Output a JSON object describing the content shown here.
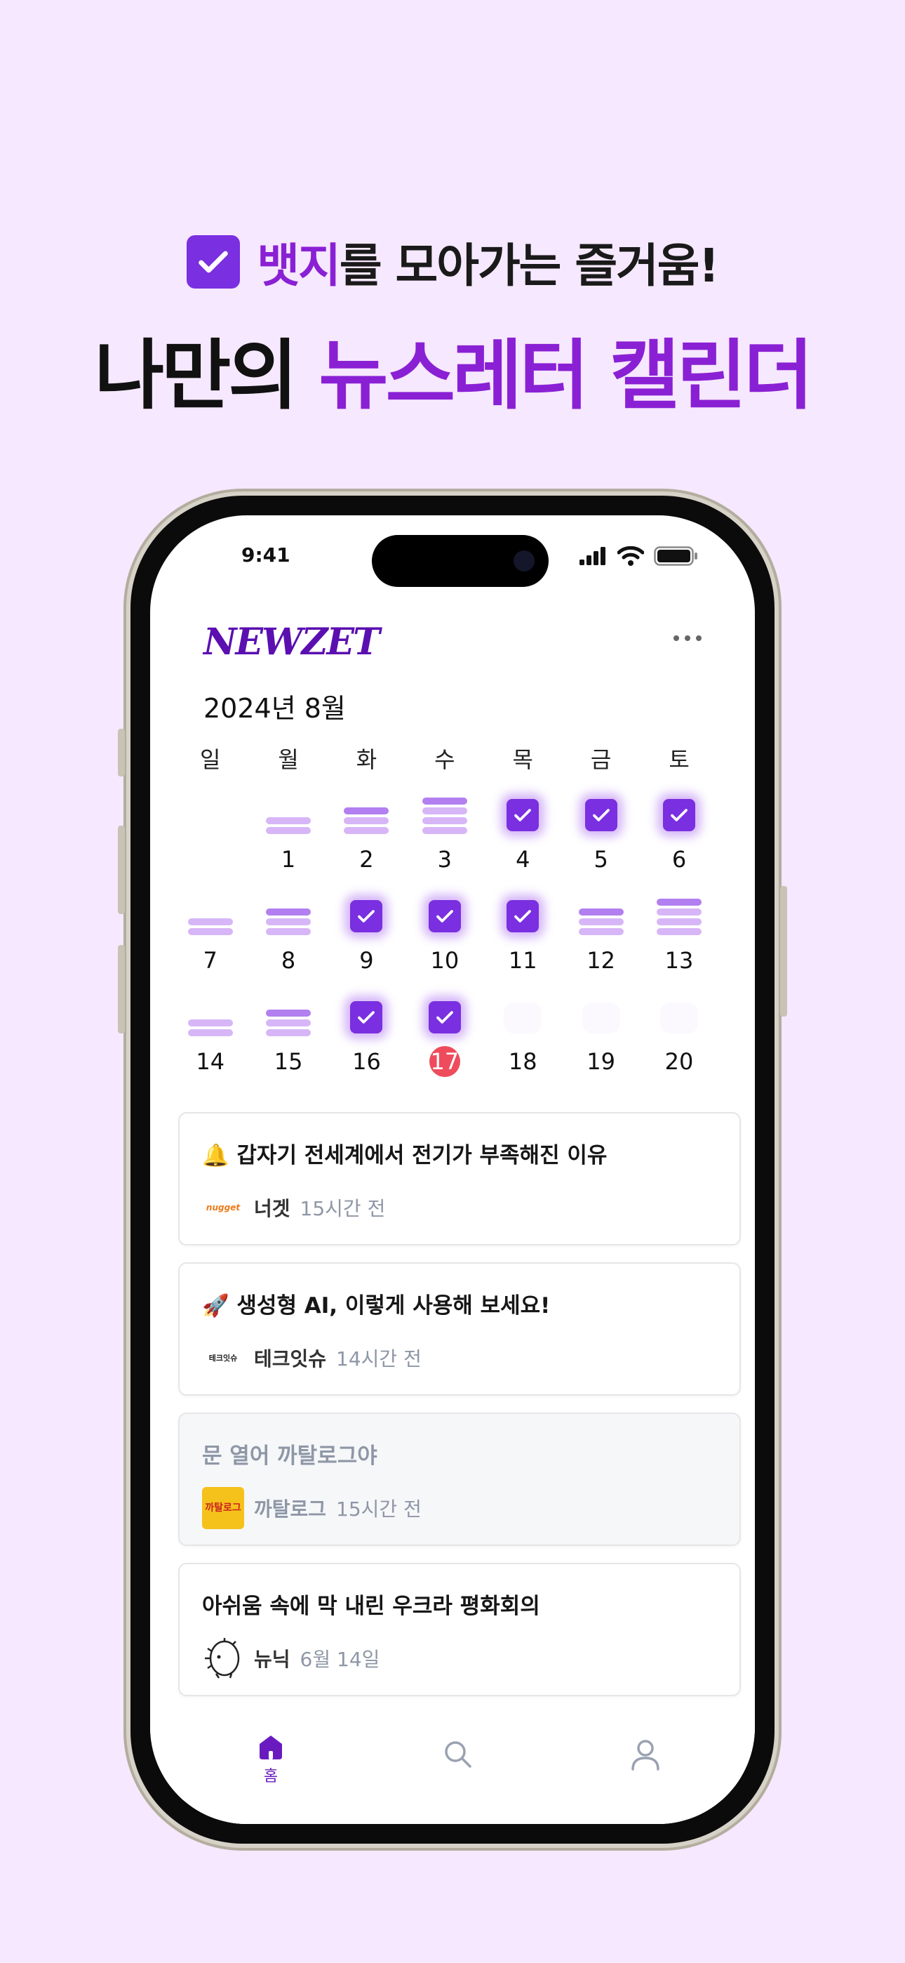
{
  "promo": {
    "line1_accent": "뱃지",
    "line1_rest": "를 모아가는 즐거움!",
    "line2_plain": "나만의 ",
    "line2_accent": "뉴스레터 캘린더"
  },
  "status_bar": {
    "time": "9:41"
  },
  "app": {
    "logo": "NEWZET",
    "menu_icon": "more-icon"
  },
  "calendar": {
    "month_label": "2024년 8월",
    "weekdays": [
      "일",
      "월",
      "화",
      "수",
      "목",
      "금",
      "토"
    ],
    "today": 17,
    "weeks": [
      [
        {
          "day": "",
          "mark": "none"
        },
        {
          "day": "1",
          "mark": "stack2"
        },
        {
          "day": "2",
          "mark": "stack3"
        },
        {
          "day": "3",
          "mark": "stack4"
        },
        {
          "day": "4",
          "mark": "badge"
        },
        {
          "day": "5",
          "mark": "badge"
        },
        {
          "day": "6",
          "mark": "badge"
        }
      ],
      [
        {
          "day": "7",
          "mark": "stack2"
        },
        {
          "day": "8",
          "mark": "stack3"
        },
        {
          "day": "9",
          "mark": "badge"
        },
        {
          "day": "10",
          "mark": "badge"
        },
        {
          "day": "11",
          "mark": "badge"
        },
        {
          "day": "12",
          "mark": "stack3"
        },
        {
          "day": "13",
          "mark": "stack4"
        }
      ],
      [
        {
          "day": "14",
          "mark": "stack2"
        },
        {
          "day": "15",
          "mark": "stack3"
        },
        {
          "day": "16",
          "mark": "badge"
        },
        {
          "day": "17",
          "mark": "badge"
        },
        {
          "day": "18",
          "mark": "ghost"
        },
        {
          "day": "19",
          "mark": "ghost"
        },
        {
          "day": "20",
          "mark": "ghost"
        }
      ]
    ]
  },
  "feed": [
    {
      "emoji": "🔔",
      "title": "갑자기 전세계에서 전기가 부족해진 이유",
      "publisher": "너겟",
      "logo_text": "nugget",
      "time": "15시간 전",
      "read": false
    },
    {
      "emoji": "🚀",
      "title": "생성형 AI, 이렇게 사용해 보세요!",
      "publisher": "테크잇슈",
      "logo_text": "테크잇슈",
      "time": "14시간 전",
      "read": false
    },
    {
      "emoji": "",
      "title": "문 열어 까탈로그야",
      "publisher": "까탈로그",
      "logo_text": "까탈로그",
      "time": "15시간 전",
      "read": true
    },
    {
      "emoji": "",
      "title": "아쉬움 속에 막 내린 우크라 평화회의",
      "publisher": "뉴닉",
      "logo_text": "",
      "time": "6월 14일",
      "read": false
    }
  ],
  "tabbar": {
    "home_label": "홈",
    "tabs": [
      "home-icon",
      "search-icon",
      "profile-icon"
    ],
    "active_color": "#6a1bbf"
  },
  "colors": {
    "accent": "#8a20d4",
    "badge": "#7a2fe0",
    "today": "#ee4c5c",
    "background": "#f6e8fe"
  }
}
